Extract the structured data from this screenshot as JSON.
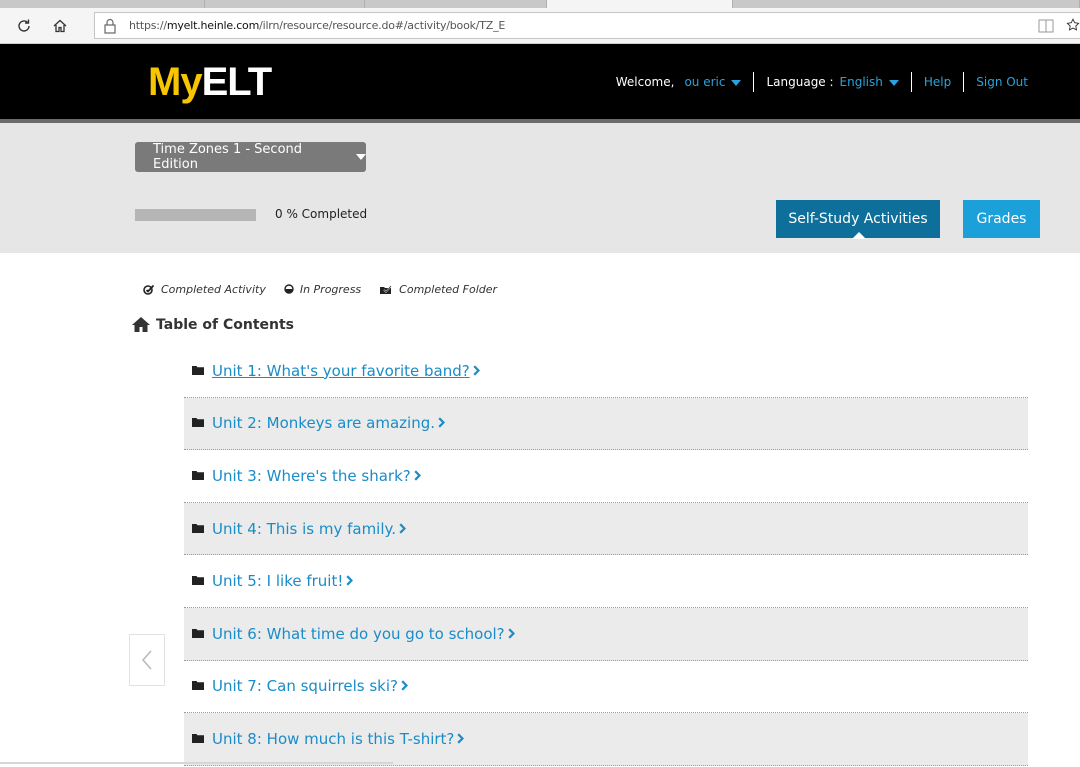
{
  "browser": {
    "url_prefix": "https://",
    "url_host": "myelt.heinle.com",
    "url_path": "/ilrn/resource/resource.do#/activity/book/TZ_E"
  },
  "header": {
    "logo_my": "My",
    "logo_elt": "ELT",
    "welcome_label": "Welcome,",
    "user_name": "ou eric",
    "language_label": "Language :",
    "language_value": "English",
    "help_label": "Help",
    "signout_label": "Sign Out"
  },
  "subband": {
    "book_title": "Time Zones 1 - Second Edition",
    "progress_percent": 0,
    "progress_text": "0 %  Completed",
    "selfstudy_label": "Self-Study Activities",
    "grades_label": "Grades"
  },
  "legend": {
    "completed_activity": "Completed Activity",
    "in_progress": "In Progress",
    "completed_folder": "Completed Folder"
  },
  "toc": {
    "heading": "Table of Contents",
    "units": [
      "Unit 1: What's your favorite band?",
      "Unit 2: Monkeys are amazing.",
      "Unit 3: Where's the shark?",
      "Unit 4: This is my family.",
      "Unit 5: I like fruit!",
      "Unit 6: What time do you go to school?",
      "Unit 7: Can squirrels ski?",
      "Unit 8: How much is this T-shirt?"
    ]
  },
  "colors": {
    "logo_yellow": "#f7c600",
    "link_blue": "#1a8cc7",
    "selfstudy_btn": "#0e6f9b",
    "grades_btn": "#1ba0da"
  }
}
